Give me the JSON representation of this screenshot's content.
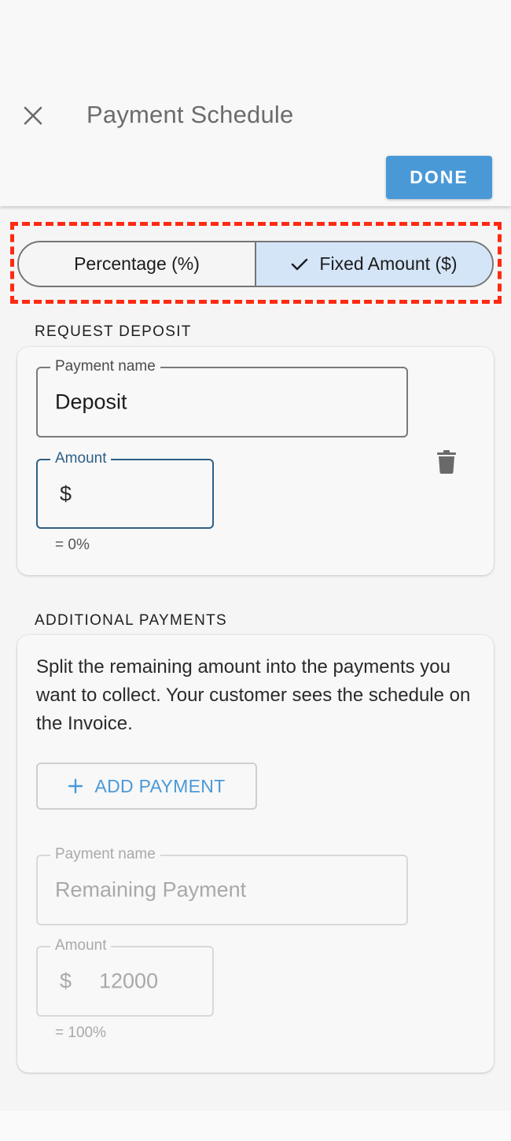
{
  "header": {
    "title": "Payment Schedule",
    "done_label": "DONE",
    "close_icon": "close-icon"
  },
  "toggle": {
    "options": [
      "Percentage (%)",
      "Fixed Amount ($)"
    ],
    "selected": "Fixed Amount ($)"
  },
  "deposit": {
    "section_label": "REQUEST DEPOSIT",
    "name_label": "Payment name",
    "name_value": "Deposit",
    "amount_label": "Amount",
    "amount_prefix": "$",
    "amount_value": "",
    "helper": "= 0%",
    "delete_icon": "trash-icon"
  },
  "additional": {
    "section_label": "ADDITIONAL PAYMENTS",
    "description": "Split the remaining amount into the payments you want to collect. Your customer sees the schedule on the Invoice.",
    "add_label": "ADD PAYMENT",
    "name_label": "Payment name",
    "name_value": "Remaining Payment",
    "amount_label": "Amount",
    "amount_prefix": "$",
    "amount_value": "12000",
    "helper": "= 100%"
  },
  "colors": {
    "accent": "#4a99d7",
    "selected_segment": "#d4e5f8",
    "highlight": "#ff2a12",
    "focus": "#2e5f86"
  }
}
